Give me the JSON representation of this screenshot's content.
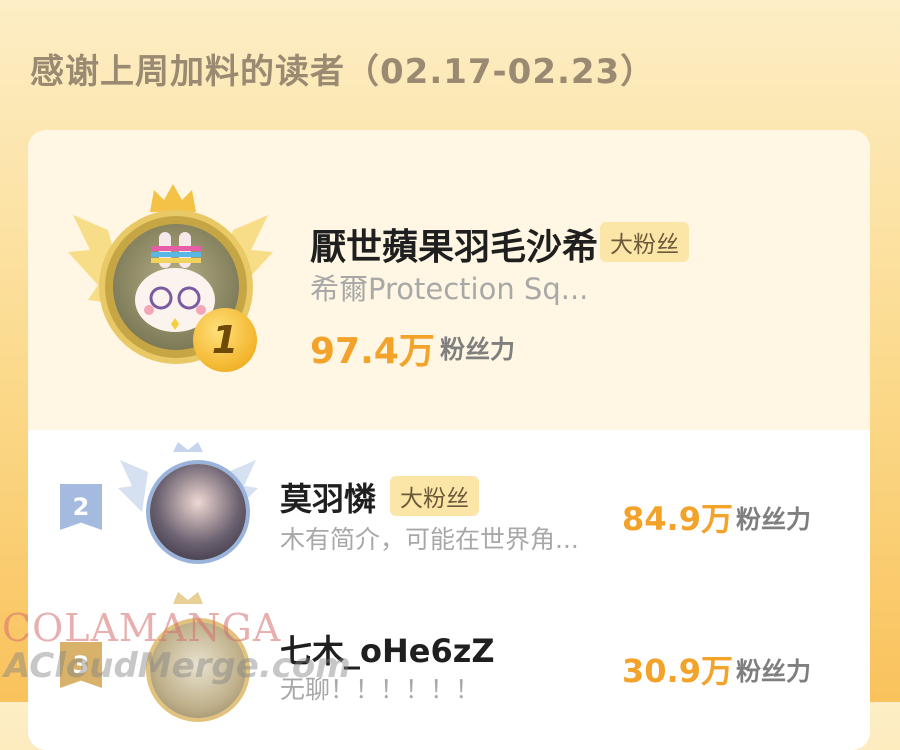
{
  "heading": "感谢上周加料的读者（02.17-02.23）",
  "readers": [
    {
      "rank": "1",
      "name": "厭世蘋果羽毛沙希",
      "tag": "大粉丝",
      "bio": "希爾Protection Sq...",
      "score": "97.4万",
      "unit": "粉丝力"
    },
    {
      "rank": "2",
      "name": "莫羽憐",
      "tag": "大粉丝",
      "bio": "木有简介，可能在世界角...",
      "score": "84.9万",
      "unit": "粉丝力"
    },
    {
      "rank": "3",
      "name": "七木_oHe6zZ",
      "tag": "",
      "bio": "无聊！！！！！！",
      "score": "30.9万",
      "unit": "粉丝力"
    }
  ],
  "watermark": {
    "line1": "COLAMANGA",
    "line2": "ACloudMerge.com"
  },
  "colors": {
    "accent": "#f3a22a",
    "background": "#fbd98a",
    "tag_bg": "#fbe6a8",
    "rank2": "#8fa8cf",
    "rank3": "#c9a25a"
  }
}
